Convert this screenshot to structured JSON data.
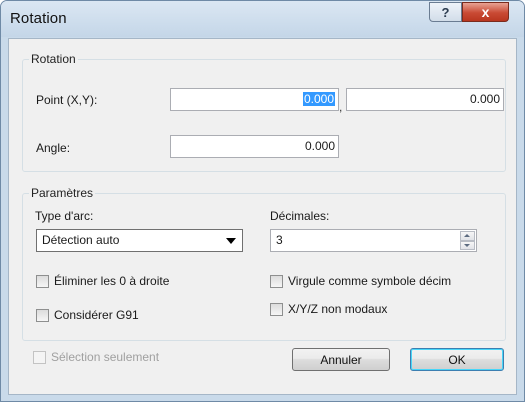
{
  "window": {
    "title": "Rotation",
    "help_glyph": "?",
    "close_glyph": "x"
  },
  "rotation_group": {
    "legend": "Rotation",
    "point_label": "Point (X,Y):",
    "point_x_value": "0.000",
    "point_separator": ",",
    "point_y_value": "0.000",
    "angle_label": "Angle:",
    "angle_value": "0.000"
  },
  "params_group": {
    "legend": "Paramètres",
    "arc_type_label": "Type d'arc:",
    "arc_type_selected": "Détection auto",
    "decimals_label": "Décimales:",
    "decimals_value": "3",
    "remove_trailing_zeros": "Éliminer les 0 à droite",
    "comma_decimal": "Virgule comme symbole décim",
    "consider_g91": "Considérer G91",
    "xyz_non_modal": "X/Y/Z non modaux"
  },
  "footer": {
    "selection_only": "Sélection seulement",
    "cancel_label": "Annuler",
    "ok_label": "OK"
  },
  "colors": {
    "selection_highlight": "#3399ff",
    "close_button_red": "#c94a34",
    "dialog_background": "#f0f0f0",
    "window_frame": "#c9daea"
  }
}
